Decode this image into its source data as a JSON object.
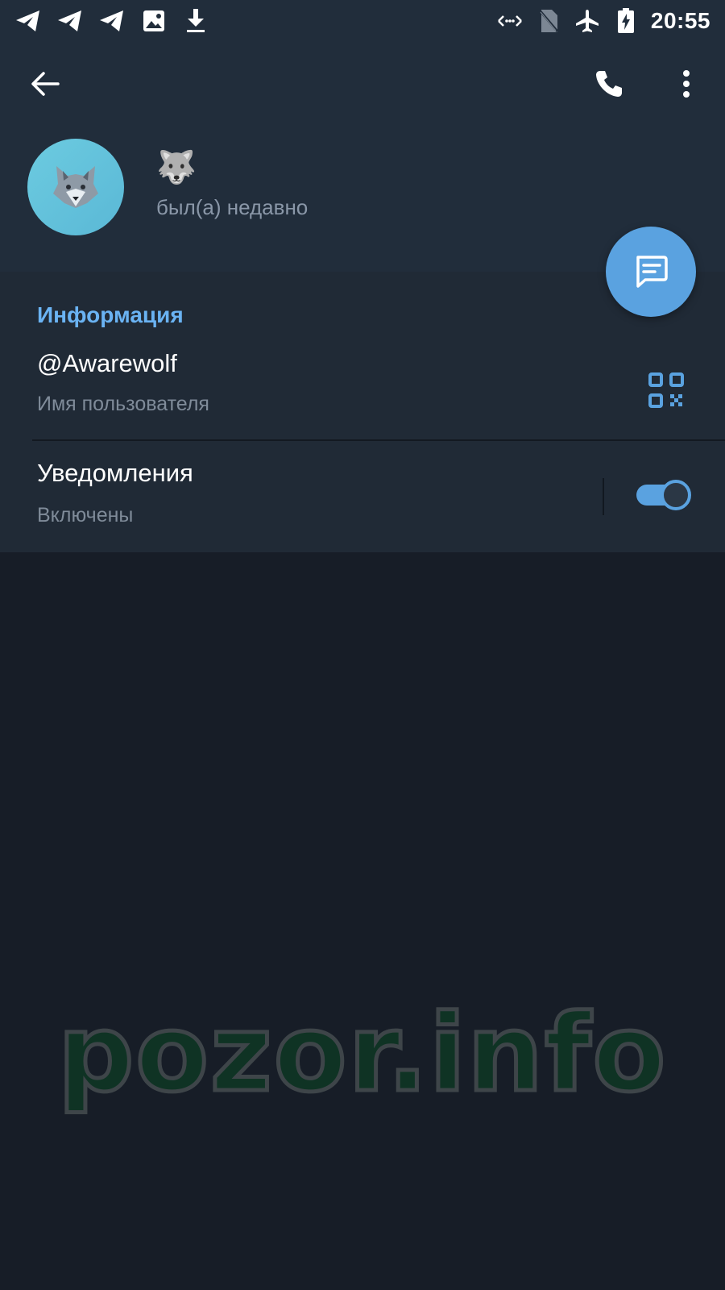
{
  "status_bar": {
    "time": "20:55",
    "left_icons": [
      "telegram-icon",
      "telegram-icon",
      "telegram-icon",
      "image-icon",
      "download-icon"
    ],
    "right_icons": [
      "data-arrows-icon",
      "no-sim-icon",
      "airplane-icon",
      "battery-charging-icon"
    ]
  },
  "toolbar": {
    "back_icon": "arrow-left-icon",
    "call_icon": "phone-icon",
    "menu_icon": "more-vertical-icon"
  },
  "profile": {
    "avatar_emoji": "🐺",
    "name": "🐺",
    "status": "был(а) недавно"
  },
  "fab": {
    "icon": "message-icon"
  },
  "info": {
    "section_title": "Информация",
    "username": {
      "value": "@Awarewolf",
      "label": "Имя пользователя",
      "icon": "qr-code-icon"
    },
    "notifications": {
      "title": "Уведомления",
      "value": "Включены",
      "enabled": true
    }
  },
  "watermark": "pozor.info",
  "colors": {
    "accent": "#5aa2e0",
    "section_title": "#6ab3f3",
    "header_bg": "#212d3b",
    "page_bg": "#171d27"
  }
}
